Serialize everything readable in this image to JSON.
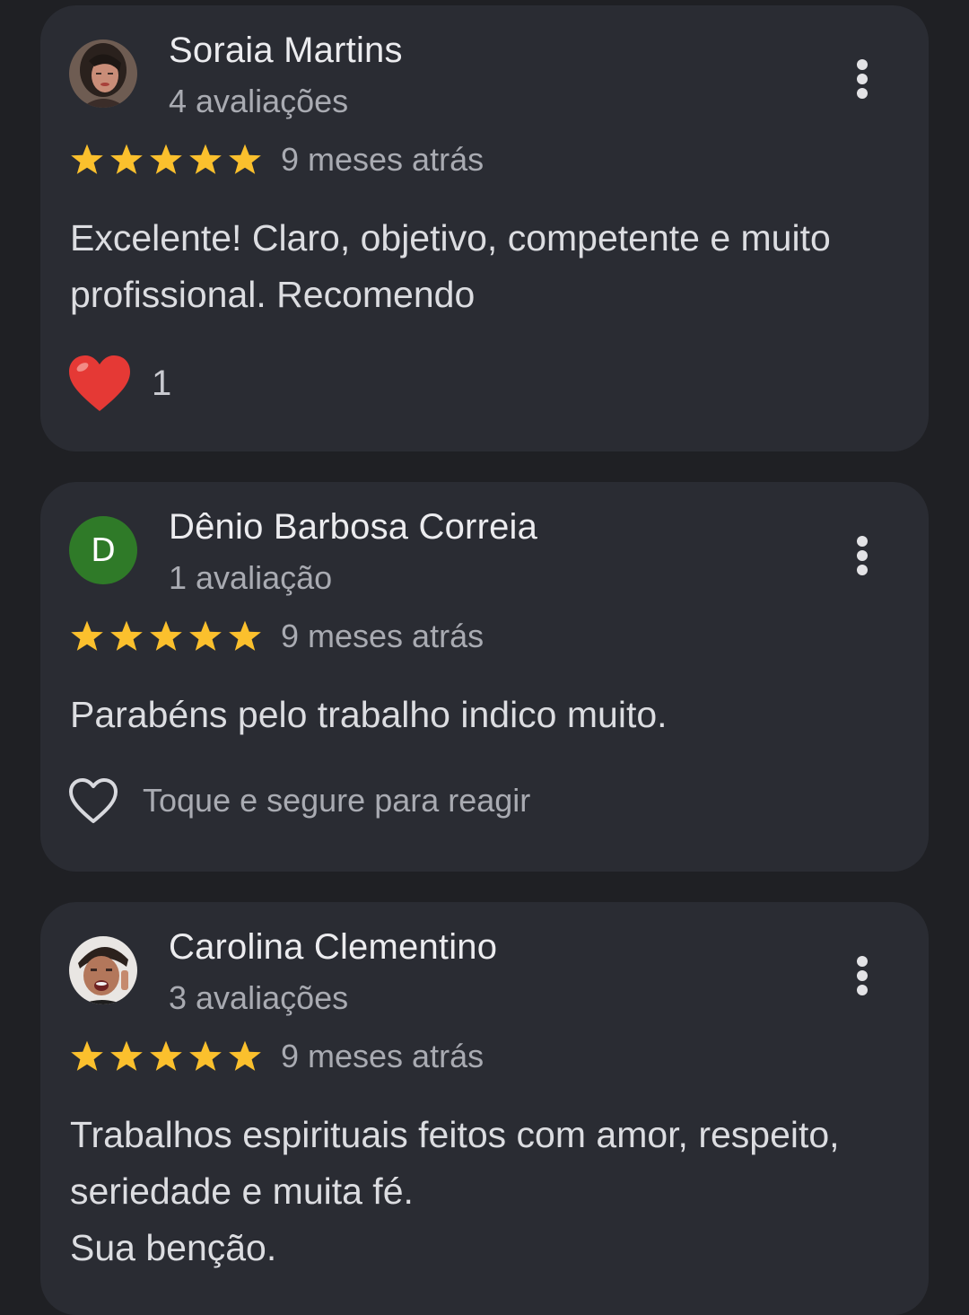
{
  "reviews": [
    {
      "name": "Soraia Martins",
      "review_count": "4 avaliações",
      "rating": 5,
      "date": "9 meses atrás",
      "text_lines": [
        "Excelente! Claro, objetivo, competente e muito",
        "profissional. Recomendo"
      ],
      "reaction": {
        "icon": "red-heart-icon",
        "count": "1"
      }
    },
    {
      "name": "Dênio Barbosa Correia",
      "avatar_letter": "D",
      "review_count": "1 avaliação",
      "rating": 5,
      "date": "9 meses atrás",
      "text_lines": [
        "Parabéns pelo trabalho indico muito."
      ],
      "reaction": {
        "icon": "heart-outline-icon",
        "hint": "Toque e segure para reagir"
      }
    },
    {
      "name": "Carolina Clementino",
      "review_count": "3 avaliações",
      "rating": 5,
      "date": "9 meses atrás",
      "text_lines": [
        "Trabalhos espirituais feitos com amor, respeito,",
        "seriedade e muita fé.",
        "Sua benção."
      ]
    }
  ],
  "colors": {
    "background": "#1f2024",
    "card": "#2a2c33",
    "star": "#fbc02d",
    "avatar_d": "#2f7a28",
    "heart": "#e53935"
  }
}
